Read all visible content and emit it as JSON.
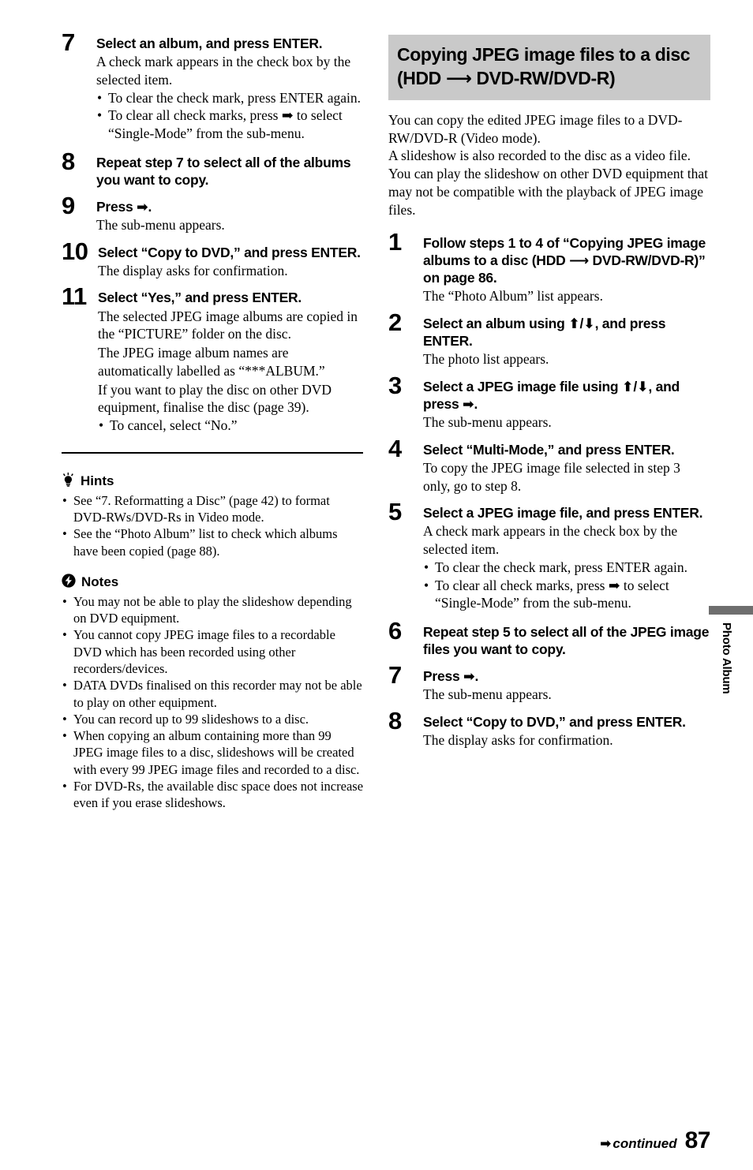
{
  "page": {
    "number": "87",
    "continued_label": "continued",
    "continued_arrow": "➡",
    "edge_tab_label": "Photo Album",
    "edge_tab_color": "#6e6e6e",
    "section_header_bg": "#c9c9c9"
  },
  "icons": {
    "right_arrow": "right-arrow-icon",
    "up_arrow": "up-arrow-icon",
    "down_arrow": "down-arrow-icon",
    "hint_bulb": "lightbulb-icon",
    "note_bolt": "lightning-bolt-icon"
  },
  "left_column": {
    "steps": [
      {
        "num": "7",
        "title": "Select an album, and press ENTER.",
        "body": "A check mark appears in the check box by the selected item.",
        "bullets": [
          "To clear the check mark, press ENTER again.",
          "To clear all check marks, press ➡ to select “Single-Mode” from the sub-menu."
        ]
      },
      {
        "num": "8",
        "title": "Repeat step 7 to select all of the albums you want to copy.",
        "body": "",
        "bullets": []
      },
      {
        "num": "9",
        "title": "Press ➡.",
        "body": "The sub-menu appears.",
        "bullets": []
      },
      {
        "num": "10",
        "title": "Select “Copy to DVD,” and press ENTER.",
        "body": "The display asks for confirmation.",
        "bullets": []
      },
      {
        "num": "11",
        "title": "Select “Yes,” and press ENTER.",
        "body": "The selected JPEG image albums are copied in the “PICTURE” folder on the disc.\nThe JPEG image album names are automatically labelled as “***ALBUM.”\nIf you want to play the disc on other DVD equipment, finalise the disc (page 39).",
        "bullets": [
          "To cancel, select “No.”"
        ]
      }
    ],
    "hints": {
      "title": "Hints",
      "items": [
        "See “7. Reformatting a Disc” (page 42) to format DVD-RWs/DVD-Rs in Video mode.",
        "See the “Photo Album” list to check which albums have been copied (page 88)."
      ]
    },
    "notes": {
      "title": "Notes",
      "items": [
        "You may not be able to play the slideshow depending on DVD equipment.",
        "You cannot copy JPEG image files to a recordable DVD which has been recorded using other recorders/devices.",
        "DATA DVDs finalised on this recorder may not be able to play on other equipment.",
        "You can record up to 99 slideshows to a disc.",
        "When copying an album containing more than 99 JPEG image files to a disc, slideshows will be created with every 99 JPEG image files and recorded to a disc.",
        "For DVD-Rs, the available disc space does not increase even if you erase slideshows."
      ]
    }
  },
  "right_column": {
    "section_title": "Copying JPEG image files to a disc (HDD ⟶ DVD-RW/DVD-R)",
    "intro": "You can copy the edited JPEG image files to a DVD-RW/DVD-R (Video mode).\nA slideshow is also recorded to the disc as a video file. You can play the slideshow on other DVD equipment that may not be compatible with the playback of JPEG image files.",
    "steps": [
      {
        "num": "1",
        "title": "Follow steps 1 to 4 of “Copying JPEG image albums to a disc (HDD ⟶ DVD-RW/DVD-R)” on page 86.",
        "body": "The “Photo Album” list appears.",
        "bullets": []
      },
      {
        "num": "2",
        "title": "Select an album using ⬆/⬇, and press ENTER.",
        "body": "The photo list appears.",
        "bullets": []
      },
      {
        "num": "3",
        "title": "Select a JPEG image file using ⬆/⬇, and press ➡.",
        "body": "The sub-menu appears.",
        "bullets": []
      },
      {
        "num": "4",
        "title": "Select “Multi-Mode,” and press ENTER.",
        "body": "To copy the JPEG image file selected in step 3 only, go to step 8.",
        "bullets": []
      },
      {
        "num": "5",
        "title": "Select a JPEG image file, and press ENTER.",
        "body": "A check mark appears in the check box by the selected item.",
        "bullets": [
          "To clear the check mark, press ENTER again.",
          "To clear all check marks, press ➡ to select “Single-Mode” from the sub-menu."
        ]
      },
      {
        "num": "6",
        "title": "Repeat step 5 to select all of the JPEG image files you want to copy.",
        "body": "",
        "bullets": []
      },
      {
        "num": "7",
        "title": "Press ➡.",
        "body": "The sub-menu appears.",
        "bullets": []
      },
      {
        "num": "8",
        "title": "Select “Copy to DVD,” and press ENTER.",
        "body": "The display asks for confirmation.",
        "bullets": []
      }
    ]
  }
}
